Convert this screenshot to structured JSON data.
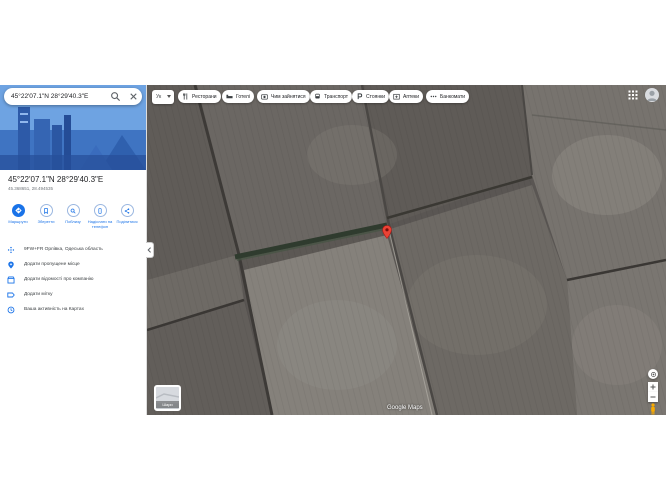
{
  "search": {
    "value": "45°22'07.1\"N 28°29'40.3\"E",
    "placeholder": ""
  },
  "place": {
    "title": "45°22'07.1\"N 28°29'40.3\"E",
    "coords": "45.368651, 28.494535",
    "address": "9FW+FR Орлівка, Одеська область"
  },
  "actions": [
    {
      "label": "Маршрути",
      "icon": "directions-icon"
    },
    {
      "label": "Зберегти",
      "icon": "bookmark-icon"
    },
    {
      "label": "Поблизу",
      "icon": "nearby-icon"
    },
    {
      "label": "Надіслати на телефон",
      "icon": "phone-icon"
    },
    {
      "label": "Поділитися",
      "icon": "share-icon"
    }
  ],
  "info_rows": [
    {
      "text": "9FW+FR Орлівка, Одеська область",
      "icon": "plus-code-icon"
    },
    {
      "text": "Додати пропущене місце",
      "icon": "add-place-icon"
    },
    {
      "text": "Додати відомості про компанію",
      "icon": "business-icon"
    },
    {
      "text": "Додати мітку",
      "icon": "label-icon"
    },
    {
      "text": "Ваша активність на Картах",
      "icon": "history-icon"
    }
  ],
  "map": {
    "language": "Ук",
    "chips": [
      {
        "label": "Ресторани",
        "icon": "restaurant-icon"
      },
      {
        "label": "Готелі",
        "icon": "hotel-icon"
      },
      {
        "label": "Чим зайнятися",
        "icon": "camera-icon"
      },
      {
        "label": "Транспорт",
        "icon": "transit-icon"
      },
      {
        "label": "Стоянки",
        "icon": "parking-icon"
      },
      {
        "label": "Аптеки",
        "icon": "pharmacy-icon"
      },
      {
        "label": "Банкомати",
        "icon": "atm-icon"
      }
    ],
    "layers_label": "Шари",
    "attribution": "Google Maps"
  },
  "colors": {
    "accent": "#1a73e8",
    "pin": "#ea4335"
  }
}
